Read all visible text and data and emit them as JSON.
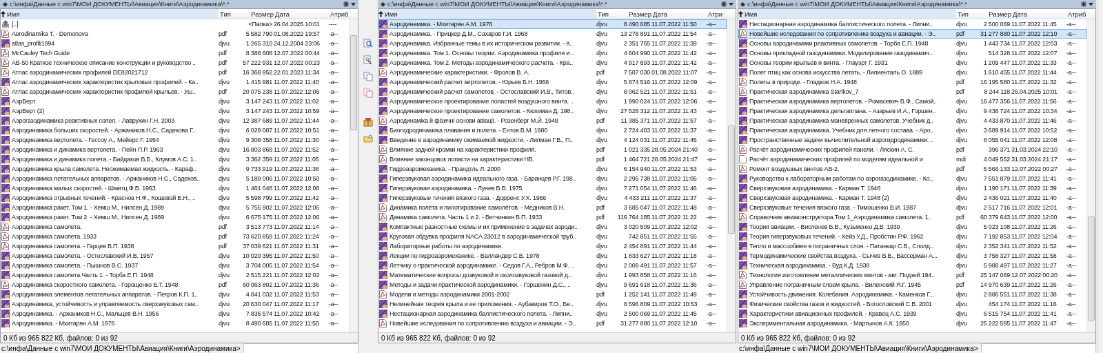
{
  "panels": [
    {
      "path": "c:\\инфа\\Данные с win7\\МОИ ДОКУМЕНТЫ\\Авиация\\Книги\\Аэродинамика\\*.*",
      "columns": [
        "Имя",
        "Тип",
        "Размер",
        "Дата",
        "Атриб"
      ],
      "rows": [
        {
          "kind": "up",
          "name": "[..]",
          "size": "<Папка>",
          "date": "26.04.2025 10:01",
          "attr": "----",
          "selected": false
        },
        {
          "kind": "pdf",
          "name": "Aerodinamika T. - Demonova",
          "type": "pdf",
          "size": "5 582 790",
          "date": "01.08.2022 19:57",
          "attr": "-a--",
          "selected": false
        },
        {
          "kind": "djvu",
          "name": "atlas_profili1994",
          "type": "djvu",
          "size": "1 265 310",
          "date": "24.12.2004 23:06",
          "attr": "-a--",
          "selected": false
        },
        {
          "kind": "pdf",
          "name": "McCauley Tech Guide",
          "type": "pdf",
          "size": "8 388 608",
          "date": "12.07.2022 00:44",
          "attr": "-a--",
          "selected": false
        },
        {
          "kind": "pdf",
          "name": "АВ-50 Краткое техническое описание конструкции и руководство ..",
          "type": "pdf",
          "size": "57 222 931",
          "date": "12.07.2022 00:23",
          "attr": "-a--",
          "selected": false
        },
        {
          "kind": "pdf",
          "name": "Атлас аэродинамических профилей DE82021712",
          "type": "pdf",
          "size": "16 368 952",
          "date": "22.01.2023 11:34",
          "attr": "-a--",
          "selected": false
        },
        {
          "kind": "djvu",
          "name": "Атлас аэродинамических характеристик крыловых профилей. - Ка..",
          "type": "djvu",
          "size": "1 415 981",
          "date": "11.07.2022 11:40",
          "attr": "-a--",
          "selected": false
        },
        {
          "kind": "pdf",
          "name": "Атлас аэродинамических характеристик профилей крыльев. - Уш..",
          "type": "pdf",
          "size": "20 075 238",
          "date": "11.07.2022 12:05",
          "attr": "-a--",
          "selected": false
        },
        {
          "kind": "djvu",
          "name": "АэрВерт",
          "type": "djvu",
          "size": "3 147 243",
          "date": "11.07.2022 11:02",
          "attr": "-a--",
          "selected": false
        },
        {
          "kind": "djvu",
          "name": "АэрВерт (2)",
          "type": "djvu",
          "size": "3 147 243",
          "date": "11.07.2022 10:59",
          "attr": "-a--",
          "selected": false
        },
        {
          "kind": "djvu",
          "name": "Аэрогазодинамика реактивных сопел. - Лаврухин Г.Н.  2003",
          "type": "djvu",
          "size": "12 387 689",
          "date": "11.07.2022 11:44",
          "attr": "-a--",
          "selected": false
        },
        {
          "kind": "djvu",
          "name": "Аэродинамика больших скоростей. - Аржаников Н.С., Садекова Г...",
          "type": "djvu",
          "size": "6 029 087",
          "date": "11.07.2022 10:51",
          "attr": "-a--",
          "selected": false
        },
        {
          "kind": "djvu",
          "name": "Аэродинамика вертолета. - Гессоу А., Мейерс Г.  1954",
          "type": "djvu",
          "size": "9 309 358",
          "date": "11.07.2022 11:30",
          "attr": "-a--",
          "selected": false
        },
        {
          "kind": "djvu",
          "name": "Аэродинамика и динамика вертолета. - Пейн П.Р.  1963",
          "type": "djvu",
          "size": "16 803 868",
          "date": "11.07.2022 11:52",
          "attr": "-a--",
          "selected": false
        },
        {
          "kind": "djvu",
          "name": "Аэродинамика и динамика полета. - Байдаков В.Б., Клумов А.С. 1..",
          "type": "djvu",
          "size": "3 362 359",
          "date": "11.07.2022 11:05",
          "attr": "-a--",
          "selected": false
        },
        {
          "kind": "djvu",
          "name": "Аэродинамика крыла самолета. Несжимаемая жидкость. - Караф..",
          "type": "djvu",
          "size": "9 733 919",
          "date": "11.07.2022 11:38",
          "attr": "-a--",
          "selected": false
        },
        {
          "kind": "djvu",
          "name": "Аэродинамика летательных аппаратов. - Аржаников Н.С., Садеков..",
          "type": "djvu",
          "size": "5 189 006",
          "date": "11.07.2022 10:50",
          "attr": "-a--",
          "selected": false
        },
        {
          "kind": "djvu",
          "name": "Аэродинамика малых скоростей. - Шмитц Ф.В.  1963",
          "type": "djvu",
          "size": "1 461 048",
          "date": "11.07.2022 12:08",
          "attr": "-a--",
          "selected": false
        },
        {
          "kind": "djvu",
          "name": "Аэродинамика отрывных течений. - Краснов Н.Ф., Кошевой В.Н., ..",
          "type": "djvu",
          "size": "5 598 799",
          "date": "11.07.2022 11:42",
          "attr": "-a--",
          "selected": false
        },
        {
          "kind": "djvu",
          "name": "Аэродинамика ракет. Том 1. - Хемш М., Нилсен Д.  1989",
          "type": "djvu",
          "size": "5 755 902",
          "date": "11.07.2022 12:05",
          "attr": "-a--",
          "selected": false
        },
        {
          "kind": "djvu",
          "name": "Аэродинамика ракет. Том 2. - Хемш М., Нилсен Д.  1989",
          "type": "djvu",
          "size": "6 675 175",
          "date": "11.07.2022 12:06",
          "attr": "-a--",
          "selected": false
        },
        {
          "kind": "pdf",
          "name": "Аэродинамика самолета.",
          "type": "pdf",
          "size": "3 513 773",
          "date": "11.07.2022 11:14",
          "attr": "-a--",
          "selected": false
        },
        {
          "kind": "pdf",
          "name": "Аэродинамика самолета.  1933",
          "type": "pdf",
          "size": "73 620 859",
          "date": "11.07.2022 11:24",
          "attr": "-a--",
          "selected": false
        },
        {
          "kind": "pdf",
          "name": "Аэродинамика самолета. - Гарцев В.П.  1938",
          "type": "pdf",
          "size": "37 039 621",
          "date": "11.07.2022 11:31",
          "attr": "-a--",
          "selected": false
        },
        {
          "kind": "djvu",
          "name": "Аэродинамика самолета. - Остославский И.В.  1957",
          "type": "djvu",
          "size": "10 020 395",
          "date": "11.07.2022 11:50",
          "attr": "-a--",
          "selected": false
        },
        {
          "kind": "djvu",
          "name": "Аэродинамика самолета. - Пышнов В.С.  1937",
          "type": "djvu",
          "size": "3 704 005",
          "date": "11.07.2022 11:54",
          "attr": "-a--",
          "selected": false
        },
        {
          "kind": "djvu",
          "name": "Аэродинамика самолета.Часть 1. - Торба Е.П.  1948",
          "type": "djvu",
          "size": "2 515 221",
          "date": "11.07.2022 12:02",
          "attr": "-a--",
          "selected": false
        },
        {
          "kind": "pdf",
          "name": "Аэродинамика скоростного самолета. - Горощенко Б.Т.  1948",
          "type": "pdf",
          "size": "60 063 802",
          "date": "11.07.2022 11:36",
          "attr": "-a--",
          "selected": false
        },
        {
          "kind": "djvu",
          "name": "Аэродинамика элементов летательных аппаратов. - Петров К.П.  1..",
          "type": "djvu",
          "size": "4 841 032",
          "date": "11.07.2022 11:53",
          "attr": "-a--",
          "selected": false
        },
        {
          "kind": "djvu",
          "name": "Аэродинамика, устойчивость и управляемость сверхзвуковых сам..",
          "type": "djvu",
          "size": "20 630 047",
          "date": "11.07.2022 11:17",
          "attr": "-a--",
          "selected": false
        },
        {
          "kind": "djvu",
          "name": "Аэродинамика. - Аржаников Н.С., Мальцев В.Н.  1956",
          "type": "djvu",
          "size": "7 836 574",
          "date": "11.07.2022 10:42",
          "attr": "-a--",
          "selected": false
        },
        {
          "kind": "djvu",
          "name": "Аэродинамика. - Мхитарян А.М.  1976",
          "type": "djvu",
          "size": "8 490 685",
          "date": "11.07.2022 11:50",
          "attr": "-a--",
          "selected": false
        }
      ],
      "status": "0 Кб из 965 822 Кб, файлов: 0 из 92",
      "command_line": "c:\\инфа\\Данные с win7\\МОИ ДОКУМЕНТЫ\\Авиация\\Книги\\Аэродинамика>"
    },
    {
      "path": "c:\\инфа\\Данные с win7\\МОИ ДОКУМЕНТЫ\\Авиация\\Книги\\Аэродинамика\\*.*",
      "columns": [
        "Имя",
        "Тип",
        "Размер",
        "Дата",
        "Атри"
      ],
      "rows": [
        {
          "kind": "djvu",
          "name": "Аэродинамика. - Мхитарян А.М.  1976",
          "type": "djvu",
          "size": "8 490 685",
          "date": "11.07.2022 11:50",
          "attr": "-a--",
          "selected": true
        },
        {
          "kind": "djvu",
          "name": "Аэродинамика. - Прицкер Д.М., Сахаров Г.И.  1968",
          "type": "djvu",
          "size": "13 278 891",
          "date": "11.07.2022 11:54",
          "attr": "-a--",
          "selected": false
        },
        {
          "kind": "djvu",
          "name": "Аэродинамика. Избранные темы в их историческом развитии. - К..",
          "type": "djvu",
          "size": "2 351 755",
          "date": "11.07.2022 11:39",
          "attr": "-a--",
          "selected": false
        },
        {
          "kind": "djvu",
          "name": "Аэродинамика. Том 1. Основы теории. Аэродинамика профиля и ..",
          "type": "djvu",
          "size": "4 604 990",
          "date": "11.07.2022 11:42",
          "attr": "-a--",
          "selected": false
        },
        {
          "kind": "djvu",
          "name": "Аэродинамика. Том 2. Методы аэродинамического расчета. - Кра..",
          "type": "djvu",
          "size": "4 917 893",
          "date": "11.07.2022 11:42",
          "attr": "-a--",
          "selected": false
        },
        {
          "kind": "pdf",
          "name": "Аэродинамические характеристики. - Фролов В. А.",
          "type": "pdf",
          "size": "7 587 030",
          "date": "01.08.2022 11:07",
          "attr": "-a--",
          "selected": false
        },
        {
          "kind": "djvu",
          "name": "Аэродинамический расчет вертолетов. - Юрьев Б.Н.  1956",
          "type": "djvu",
          "size": "5 874 516",
          "date": "11.07.2022 12:09",
          "attr": "-a--",
          "selected": false
        },
        {
          "kind": "djvu",
          "name": "Аэродинамический расчет самолетов. - Остославский И.В., Титов..",
          "type": "djvu",
          "size": "8 062 521",
          "date": "11.07.2022 11:51",
          "attr": "-a--",
          "selected": false
        },
        {
          "kind": "djvu",
          "name": "Аэродинамическое проектирование лопастей воздушного винта. ..",
          "type": "djvu",
          "size": "1 990 024",
          "date": "11.07.2022 12:06",
          "attr": "-a--",
          "selected": false
        },
        {
          "kind": "djvu",
          "name": "Аэродинамическое проектирование самолетов. - Кюхеман Д.  198..",
          "type": "djvu",
          "size": "27 528 312",
          "date": "11.07.2022 11:43",
          "attr": "-a--",
          "selected": false
        },
        {
          "kind": "pdf",
          "name": "Аэродинаміка й фізичні основи авіації. - Розенберг М.Й.  1948",
          "type": "pdf",
          "size": "11 385 371",
          "date": "11.07.2022 11:57",
          "attr": "-a--",
          "selected": false
        },
        {
          "kind": "djvu",
          "name": "Биогидродинамика плавания и полета. - Ентов В.М.  1980",
          "type": "djvu",
          "size": "2 724 403",
          "date": "11.07.2022 11:37",
          "attr": "-a--",
          "selected": false
        },
        {
          "kind": "djvu",
          "name": "Введение в аэродинамику сжимаемой жидкости. - Липман Г.В., П..",
          "type": "djvu",
          "size": "4 124 031",
          "date": "11.07.2022 11:45",
          "attr": "-a--",
          "selected": false
        },
        {
          "kind": "pdf",
          "name": "Влияние задней кромки на характеристики профиля.",
          "type": "pdf",
          "size": "1 021 335",
          "date": "28.05.2024 21:40",
          "attr": "-a--",
          "selected": false
        },
        {
          "kind": "pdf",
          "name": "Влияние законцовок лопасти на характеристики НВ.",
          "type": "pdf",
          "size": "1 464 721",
          "date": "28.05.2024 21:47",
          "attr": "-a--",
          "selected": false
        },
        {
          "kind": "djvu",
          "name": "Гидроаэромеханика. - Прандтль Л.  2000",
          "type": "djvu",
          "size": "6 154 940",
          "date": "11.07.2022 11:53",
          "attr": "-a--",
          "selected": false
        },
        {
          "kind": "djvu",
          "name": "Гиперзвуковая аэродинамика идеального газа. - Баранцев Р.Г.  198..",
          "type": "djvu",
          "size": "2 295 738",
          "date": "11.07.2022 11:05",
          "attr": "-a--",
          "selected": false
        },
        {
          "kind": "djvu",
          "name": "Гиперзвуковая аэродинамика. - Лунев В.В.  1975",
          "type": "djvu",
          "size": "7 271 054",
          "date": "11.07.2022 11:46",
          "attr": "-a--",
          "selected": false
        },
        {
          "kind": "djvu",
          "name": "Гиперзвуковые течения вязкого газа. - Дорренс У.Х.  1966",
          "type": "djvu",
          "size": "4 433 211",
          "date": "11.07.2022 11:37",
          "attr": "-a--",
          "selected": false
        },
        {
          "kind": "pdf",
          "name": "Динамика полёта и пилотирование самолётов. - Медников В.Н.",
          "type": "pdf",
          "size": "3 685 047",
          "date": "11.07.2022 11:48",
          "attr": "-a--",
          "selected": false
        },
        {
          "kind": "pdf",
          "name": "Динамика самолета. Часть 1 и 2. - Ветчинкин В.П.  1933",
          "type": "pdf",
          "size": "116 764 185",
          "date": "11.07.2022 11:22",
          "attr": "-a--",
          "selected": false
        },
        {
          "kind": "djvu",
          "name": "Компактные разностные схемы и их применение в задачах аэроди..",
          "type": "djvu",
          "size": "3 020 509",
          "date": "11.07.2022 12:02",
          "attr": "-a--",
          "selected": false
        },
        {
          "kind": "djvu",
          "name": "Круговая обдувка профиля NACA 23012 в аэродинамической труб..",
          "type": "djvu",
          "size": "742 851",
          "date": "11.07.2022 11:55",
          "attr": "-a--",
          "selected": false
        },
        {
          "kind": "djvu",
          "name": "Лабораторные работы по аэродинамике.",
          "type": "djvu",
          "size": "2 454 891",
          "date": "11.07.2022 11:44",
          "attr": "-a--",
          "selected": false
        },
        {
          "kind": "djvu",
          "name": "Лекции по гидроаэромеханике. - Валландер С.В.  1978",
          "type": "djvu",
          "size": "1 833 627",
          "date": "11.07.2022 11:18",
          "attr": "-a--",
          "selected": false
        },
        {
          "kind": "djvu",
          "name": "Летчику о практической аэродинамике. - Седов Г.А., Ребров М.Ф. ..",
          "type": "djvu",
          "size": "2 009 491",
          "date": "11.07.2022 11:57",
          "attr": "-a--",
          "selected": false
        },
        {
          "kind": "djvu",
          "name": "Математические вопросы дозвуковой и околозвуковой газовой д..",
          "type": "djvu",
          "size": "1 993 858",
          "date": "11.07.2022 11:16",
          "attr": "-a--",
          "selected": false
        },
        {
          "kind": "djvu",
          "name": "Методы и задачи практической аэродинамики. - Горшенин Д.С., ..",
          "type": "djvu",
          "size": "9 691 618",
          "date": "11.07.2022 11:36",
          "attr": "-a--",
          "selected": false
        },
        {
          "kind": "pdf",
          "name": "Модели и методы аэродинамики 2001-2002",
          "type": "pdf",
          "size": "1 252 141",
          "date": "11.07.2022 11:49",
          "attr": "-a--",
          "selected": false
        },
        {
          "kind": "djvu",
          "name": "Нелинейная теория крыла и ее приложения. - Аубакиров Т.О., Бе..",
          "type": "djvu",
          "size": "8 596 809",
          "date": "11.07.2022 10:53",
          "attr": "-a--",
          "selected": false
        },
        {
          "kind": "djvu",
          "name": "Нестационарная аэродинамика баллистического полета. - Липни..",
          "type": "djvu",
          "size": "2 500 069",
          "date": "11.07.2022 11:45",
          "attr": "-a--",
          "selected": false
        },
        {
          "kind": "pdf",
          "name": "Новейшие иследования по сопротивлению воздуха и авиации. - Э..",
          "type": "pdf",
          "size": "31 277 880",
          "date": "11.07.2022 12:10",
          "attr": "-a--",
          "selected": false
        }
      ],
      "status": "0 Кб из 965 822 Кб, файлов: 0 из 92"
    },
    {
      "path": "c:\\инфа\\Данные с win7\\МОИ ДОКУМЕНТЫ\\Авиация\\Книги\\Аэродинамика\\*.*",
      "columns": [
        "Имя",
        "Тип",
        "Размер",
        "Дата",
        "Атриб"
      ],
      "rows": [
        {
          "kind": "djvu",
          "name": "Нестационарная аэродинамика баллистического полета. - Липни..",
          "type": "djvu",
          "size": "2 500 069",
          "date": "11.07.2022 11:45",
          "attr": "-a--",
          "selected": false
        },
        {
          "kind": "pdf",
          "name": "Новейшие иследования по сопротивлению воздуха и авиации. - Э..",
          "type": "pdf",
          "size": "31 277 880",
          "date": "11.07.2022 12:10",
          "attr": "-a--",
          "selected": true
        },
        {
          "kind": "djvu",
          "name": "Основы аэродинамики реактивных самолетов. - Торба Е.П.  1948",
          "type": "djvu",
          "size": "1 443 734",
          "date": "11.07.2022 12:03",
          "attr": "-a--",
          "selected": false
        },
        {
          "kind": "djvu",
          "name": "Основы прикладной газодинамики. Моделирование газодинамич..",
          "type": "djvu",
          "size": "514 328",
          "date": "11.07.2022 12:07",
          "attr": "-a--",
          "selected": false
        },
        {
          "kind": "djvu",
          "name": "Основы теории крыльев и винта. - Глауэрт Г.  1931",
          "type": "djvu",
          "size": "1 209 447",
          "date": "11.07.2022 11:33",
          "attr": "-a--",
          "selected": false
        },
        {
          "kind": "djvu",
          "name": "Полет птиц как основа искусства летать. - Лилиенталь О.  1889",
          "type": "djvu",
          "size": "1 610 455",
          "date": "11.07.2022 11:44",
          "attr": "-a--",
          "selected": false
        },
        {
          "kind": "pdf",
          "name": "Полеты в природе. - Гладков Н.А.  1948",
          "type": "pdf",
          "size": "16 195 580",
          "date": "11.07.2022 11:32",
          "attr": "-a--",
          "selected": false
        },
        {
          "kind": "pdf",
          "name": "Практическая аэродинамика Starikov_7",
          "type": "pdf",
          "size": "8 244 118",
          "date": "26.04.2025 10:01",
          "attr": "-a--",
          "selected": false
        },
        {
          "kind": "djvu",
          "name": "Практическая аэродинамика вертолетов. - Ромасевич В.Ф., Самой..",
          "type": "djvu",
          "size": "16 477 356",
          "date": "11.07.2022 11:56",
          "attr": "-a--",
          "selected": false
        },
        {
          "kind": "djvu",
          "name": "Практическая аэродинамика дельтаплана. - Азарьев И.А., Горшен..",
          "type": "djvu",
          "size": "9 438 724",
          "date": "11.07.2022 10:34",
          "attr": "-a--",
          "selected": false
        },
        {
          "kind": "djvu",
          "name": "Практическая аэродинамика маневренных самолетов. Учебник д..",
          "type": "djvu",
          "size": "4 433 870",
          "date": "11.07.2022 11:46",
          "attr": "-a--",
          "selected": false
        },
        {
          "kind": "djvu",
          "name": "Практическая аэродинамика. Учебник для летного состава. - Аро..",
          "type": "djvu",
          "size": "3 689 914",
          "date": "11.07.2022 10:52",
          "attr": "-a--",
          "selected": false
        },
        {
          "kind": "djvu",
          "name": "Пространственные задачи вычислительной аэрогидродинамики. ..",
          "type": "djvu",
          "size": "8 055 041",
          "date": "11.07.2022 12:08",
          "attr": "-a--",
          "selected": false
        },
        {
          "kind": "pdf",
          "name": "Расчёт аэродинамических профилей панели. - Ляскин А. С.",
          "type": "pdf",
          "size": "396 371",
          "date": "31.03.2024 22:10",
          "attr": "-a--",
          "selected": false
        },
        {
          "kind": "blank",
          "name": "Расчёт аэродинамических профилей по моделям идеальной и",
          "type": "mdi",
          "size": "4 049 552",
          "date": "31.03.2024 21:17",
          "attr": "-a--",
          "selected": false
        },
        {
          "kind": "pdf",
          "name": "Ремонт воздушных винтов АВ-2.",
          "type": "pdf",
          "size": "5 566 133",
          "date": "12.07.2022 00:27",
          "attr": "-a--",
          "selected": false
        },
        {
          "kind": "djvu",
          "name": "Руководство к лабораторным работам по аэрогазодинамике. - Ко..",
          "type": "djvu",
          "size": "7 551 879",
          "date": "11.07.2022 11:41",
          "attr": "-a--",
          "selected": false
        },
        {
          "kind": "djvu",
          "name": "Сверхзвуковая аэродинамика. - Карман Т.  1948",
          "type": "djvu",
          "size": "1 190 171",
          "date": "11.07.2022 11:39",
          "attr": "-a--",
          "selected": false
        },
        {
          "kind": "djvu",
          "name": "Сверхзвуковая аэродинамика. - Карман Т.  1948   (2)",
          "type": "djvu",
          "size": "2 436 021",
          "date": "11.07.2022 11:40",
          "attr": "-a--",
          "selected": false
        },
        {
          "kind": "djvu",
          "name": "Сверхзвуковые течения вязкого газа. - Тимошенко В.И.  1987",
          "type": "djvu",
          "size": "2 517 716",
          "date": "11.07.2022 12:01",
          "attr": "-a--",
          "selected": false
        },
        {
          "kind": "pdf",
          "name": "Справочник авиаконструктора.Том 1_Аэродинамика самолета.  1..",
          "type": "pdf",
          "size": "60 379 643",
          "date": "11.07.2022 12:00",
          "attr": "-a--",
          "selected": false
        },
        {
          "kind": "djvu",
          "name": "Теория авиации. - Висленев Б.В., Кузьменко Д.В.  1939",
          "type": "djvu",
          "size": "5 023 108",
          "date": "11.07.2022 11:26",
          "attr": "-a--",
          "selected": false
        },
        {
          "kind": "djvu",
          "name": "Теория гиперзвуковых течений. - Хейз У.Д., Пробстин Р.Ф.  1962",
          "type": "djvu",
          "size": "7 192 853",
          "date": "11.07.2022 12:04",
          "attr": "-a--",
          "selected": false
        },
        {
          "kind": "djvu",
          "name": "Тепло и массообмен в пограничных слоя. - Патанкар С.В., Сполд..",
          "type": "djvu",
          "size": "2 352 341",
          "date": "11.07.2022 11:52",
          "attr": "-a--",
          "selected": false
        },
        {
          "kind": "djvu",
          "name": "Термодинамические свойства воздуха. - Сычев В.В., Вассерман А...",
          "type": "djvu",
          "size": "3 758 327",
          "date": "11.07.2022 11:58",
          "attr": "-a--",
          "selected": false
        },
        {
          "kind": "djvu",
          "name": "Техническая аэродинамика. - Вуд К.Д.  1938",
          "type": "djvu",
          "size": "5 988 497",
          "date": "11.07.2022 11:27",
          "attr": "-a--",
          "selected": false
        },
        {
          "kind": "pdf",
          "name": "Технология изготовление металлических винтов - авт. Подзей 194..",
          "type": "pdf",
          "size": "25 147 069",
          "date": "12.07.2022 00:20",
          "attr": "-a--",
          "selected": false
        },
        {
          "kind": "pdf",
          "name": "Управление пограничным слоем крыла. - Виленский Я.Г.  1945",
          "type": "pdf",
          "size": "14 970 639",
          "date": "11.07.2022 11:26",
          "attr": "-a--",
          "selected": false
        },
        {
          "kind": "djvu",
          "name": "Устойчивость движения. Колебания. Аэродинамика. - Каменков Г...",
          "type": "djvu",
          "size": "2 886 551",
          "date": "11.07.2022 11:38",
          "attr": "-a--",
          "selected": false
        },
        {
          "kind": "djvu",
          "name": "Физические свойства газов и жидкостей. - Богословский С.В.  2001",
          "type": "djvu",
          "size": "454 174",
          "date": "11.07.2022 11:16",
          "attr": "-a--",
          "selected": false
        },
        {
          "kind": "djvu",
          "name": "Характеристики авиационных профилей. - Кравец А.С.  1939",
          "type": "djvu",
          "size": "6 515 754",
          "date": "11.07.2022 11:41",
          "attr": "-a--",
          "selected": false
        },
        {
          "kind": "djvu",
          "name": "Экспериментальная аэродинамика. - Мартынов А.К.  1950",
          "type": "djvu",
          "size": "25 222 595",
          "date": "11.07.2022 11:47",
          "attr": "-a--",
          "selected": false
        }
      ],
      "status": "0 Кб из 965 822 Кб, файлов: 0 из 92",
      "command_line": "c:\\инфа\\Данные с win7\\МОИ ДОКУМЕНТЫ\\Авиация\\Книги\\Аэродинамика>"
    }
  ]
}
